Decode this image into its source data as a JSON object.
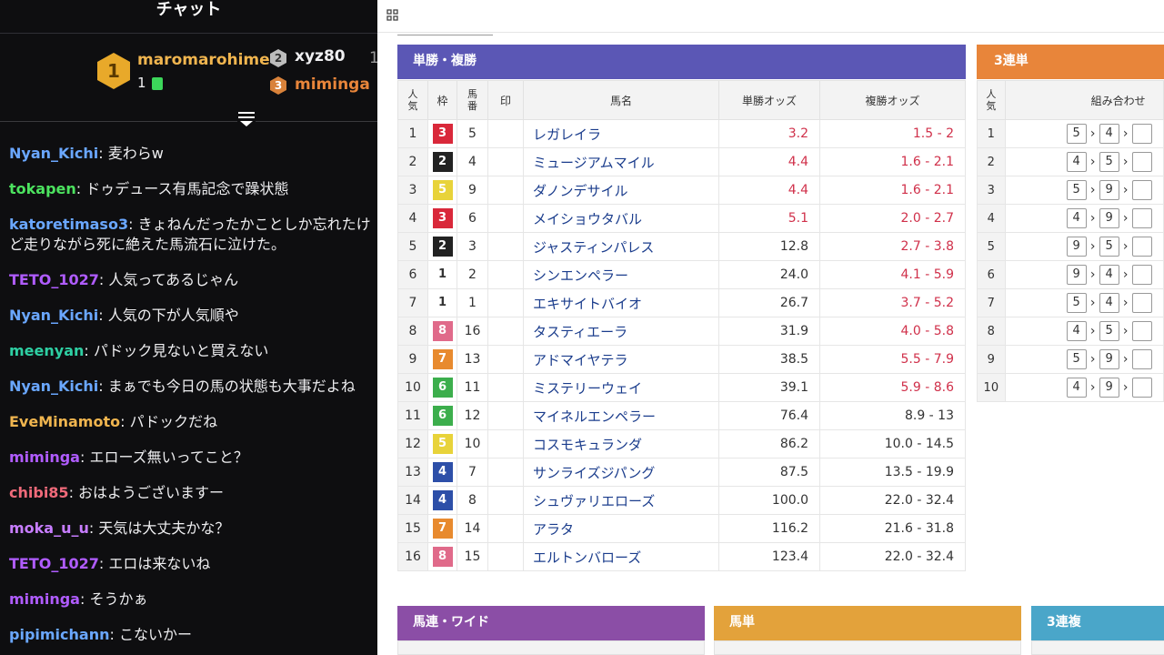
{
  "chat": {
    "title": "チャット",
    "leaderboard": {
      "first": {
        "rank": "1",
        "name": "maromarohime",
        "count": "1"
      },
      "second": {
        "rank": "2",
        "name": "xyz80",
        "trail": "1"
      },
      "third": {
        "rank": "3",
        "name": "miminga"
      }
    },
    "messages": [
      {
        "user": "Nyan_Kichi",
        "color": "#6aa7ff",
        "text": "麦わらw"
      },
      {
        "user": "tokapen",
        "color": "#4ce35f",
        "text": "ドゥデュース有馬記念で躁状態"
      },
      {
        "user": "katoretimaso3",
        "color": "#6aa7ff",
        "text": "きょねんだったかことしか忘れたけど走りながら死に絶えた馬流石に泣けた。"
      },
      {
        "user": "TETO_1027",
        "color": "#b05cff",
        "text": "人気ってあるじゃん"
      },
      {
        "user": "Nyan_Kichi",
        "color": "#6aa7ff",
        "text": "人気の下が人気順や"
      },
      {
        "user": "meenyan",
        "color": "#2ecfa3",
        "text": "パドック見ないと買えない"
      },
      {
        "user": "Nyan_Kichi",
        "color": "#6aa7ff",
        "text": "まぁでも今日の馬の状態も大事だよね"
      },
      {
        "user": "EveMinamoto",
        "color": "#f0b54f",
        "text": "パドックだね"
      },
      {
        "user": "miminga",
        "color": "#b05cff",
        "text": "エローズ無いってこと？"
      },
      {
        "user": "chibi85",
        "color": "#f06a7a",
        "text": "おはようございますー"
      },
      {
        "user": "moka_u_u",
        "color": "#c77dff",
        "text": "天気は大丈夫かな？"
      },
      {
        "user": "TETO_1027",
        "color": "#b05cff",
        "text": "エロは来ないね"
      },
      {
        "user": "miminga",
        "color": "#b05cff",
        "text": "そうかぁ"
      },
      {
        "user": "pipimichann",
        "color": "#6aa7ff",
        "text": "こないかー"
      }
    ]
  },
  "win_place": {
    "title": "単勝・複勝",
    "header_color": "#5b57b5",
    "columns": {
      "pop": "人気",
      "waku": "枠",
      "num": "馬番",
      "mark": "印",
      "name": "馬名",
      "win": "単勝オッズ",
      "place": "複勝オッズ"
    },
    "rows": [
      {
        "pop": "1",
        "waku": "3",
        "num": "5",
        "name": "レガレイラ",
        "win": "3.2",
        "place": "1.5 - 2",
        "hot": true
      },
      {
        "pop": "2",
        "waku": "2",
        "num": "4",
        "name": "ミュージアムマイル",
        "win": "4.4",
        "place": "1.6 - 2.1",
        "hot": true
      },
      {
        "pop": "3",
        "waku": "5",
        "num": "9",
        "name": "ダノンデサイル",
        "win": "4.4",
        "place": "1.6 - 2.1",
        "hot": true
      },
      {
        "pop": "4",
        "waku": "3",
        "num": "6",
        "name": "メイショウタバル",
        "win": "5.1",
        "place": "2.0 - 2.7",
        "hot": true
      },
      {
        "pop": "5",
        "waku": "2",
        "num": "3",
        "name": "ジャスティンパレス",
        "win": "12.8",
        "place": "2.7 - 3.8",
        "hot": false,
        "hot_place": true
      },
      {
        "pop": "6",
        "waku": "1",
        "num": "2",
        "name": "シンエンペラー",
        "win": "24.0",
        "place": "4.1 - 5.9",
        "hot": false,
        "hot_place": true
      },
      {
        "pop": "7",
        "waku": "1",
        "num": "1",
        "name": "エキサイトバイオ",
        "win": "26.7",
        "place": "3.7 - 5.2",
        "hot": false,
        "hot_place": true
      },
      {
        "pop": "8",
        "waku": "8",
        "num": "16",
        "name": "タスティエーラ",
        "win": "31.9",
        "place": "4.0 - 5.8",
        "hot": false,
        "hot_place": true
      },
      {
        "pop": "9",
        "waku": "7",
        "num": "13",
        "name": "アドマイヤテラ",
        "win": "38.5",
        "place": "5.5 - 7.9",
        "hot": false,
        "hot_place": true
      },
      {
        "pop": "10",
        "waku": "6",
        "num": "11",
        "name": "ミステリーウェイ",
        "win": "39.1",
        "place": "5.9 - 8.6",
        "hot": false,
        "hot_place": true
      },
      {
        "pop": "11",
        "waku": "6",
        "num": "12",
        "name": "マイネルエンペラー",
        "win": "76.4",
        "place": "8.9 - 13"
      },
      {
        "pop": "12",
        "waku": "5",
        "num": "10",
        "name": "コスモキュランダ",
        "win": "86.2",
        "place": "10.0 - 14.5"
      },
      {
        "pop": "13",
        "waku": "4",
        "num": "7",
        "name": "サンライズジパング",
        "win": "87.5",
        "place": "13.5 - 19.9"
      },
      {
        "pop": "14",
        "waku": "4",
        "num": "8",
        "name": "シュヴァリエローズ",
        "win": "100.0",
        "place": "22.0 - 32.4"
      },
      {
        "pop": "15",
        "waku": "7",
        "num": "14",
        "name": "アラタ",
        "win": "116.2",
        "place": "21.6 - 31.8"
      },
      {
        "pop": "16",
        "waku": "8",
        "num": "15",
        "name": "エルトンバローズ",
        "win": "123.4",
        "place": "22.0 - 32.4"
      }
    ]
  },
  "waku_colors": {
    "1": {
      "bg": "#ffffff",
      "fg": "#333333"
    },
    "2": {
      "bg": "#222222",
      "fg": "#ffffff"
    },
    "3": {
      "bg": "#d9283a",
      "fg": "#ffffff"
    },
    "4": {
      "bg": "#2d4fa8",
      "fg": "#ffffff"
    },
    "5": {
      "bg": "#e8d33a",
      "fg": "#ffffff"
    },
    "6": {
      "bg": "#3cae4c",
      "fg": "#ffffff"
    },
    "7": {
      "bg": "#e88a2e",
      "fg": "#ffffff"
    },
    "8": {
      "bg": "#e06a8a",
      "fg": "#ffffff"
    }
  },
  "trifecta": {
    "title": "3連単",
    "header_color": "#e8853a",
    "columns": {
      "pop": "人気",
      "combo": "組み合わせ"
    },
    "rows": [
      {
        "pop": "1",
        "a": "5",
        "b": "4"
      },
      {
        "pop": "2",
        "a": "4",
        "b": "5"
      },
      {
        "pop": "3",
        "a": "5",
        "b": "9"
      },
      {
        "pop": "4",
        "a": "4",
        "b": "9"
      },
      {
        "pop": "5",
        "a": "9",
        "b": "5"
      },
      {
        "pop": "6",
        "a": "9",
        "b": "4"
      },
      {
        "pop": "7",
        "a": "5",
        "b": "4"
      },
      {
        "pop": "8",
        "a": "4",
        "b": "5"
      },
      {
        "pop": "9",
        "a": "5",
        "b": "9"
      },
      {
        "pop": "10",
        "a": "4",
        "b": "9"
      }
    ]
  },
  "bottom_sections": [
    {
      "title": "馬連・ワイド",
      "color": "#8b4ea6"
    },
    {
      "title": "馬単",
      "color": "#e3a23b"
    },
    {
      "title": "3連複",
      "color": "#4aa6c9"
    }
  ]
}
